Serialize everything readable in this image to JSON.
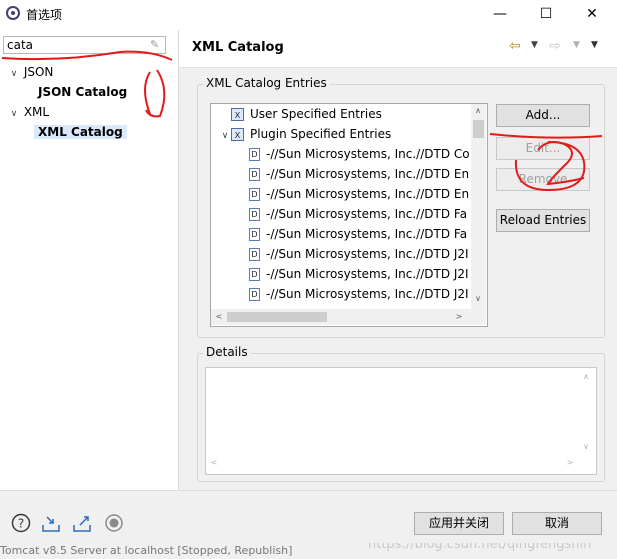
{
  "window": {
    "title": "首选项",
    "controls": {
      "minimize": "—",
      "maximize": "☐",
      "close": "✕"
    }
  },
  "filter": {
    "value": "cata"
  },
  "tree": [
    {
      "label": "JSON",
      "expanded": true
    },
    {
      "label": "JSON Catalog",
      "bold": true
    },
    {
      "label": "XML",
      "expanded": true
    },
    {
      "label": "XML Catalog",
      "bold": true,
      "selected": true
    }
  ],
  "page": {
    "title": "XML Catalog"
  },
  "entries_group": {
    "legend": "XML Catalog Entries",
    "items": [
      {
        "label": "User Specified Entries",
        "icon": "catalog-icon"
      },
      {
        "label": "Plugin Specified Entries",
        "icon": "catalog-icon",
        "expanded": true
      },
      {
        "label": "-//Sun Microsystems, Inc.//DTD Co",
        "icon": "dtd-icon"
      },
      {
        "label": "-//Sun Microsystems, Inc.//DTD En",
        "icon": "dtd-icon"
      },
      {
        "label": "-//Sun Microsystems, Inc.//DTD En",
        "icon": "dtd-icon"
      },
      {
        "label": "-//Sun Microsystems, Inc.//DTD Fa",
        "icon": "dtd-icon"
      },
      {
        "label": "-//Sun Microsystems, Inc.//DTD Fa",
        "icon": "dtd-icon"
      },
      {
        "label": "-//Sun Microsystems, Inc.//DTD J2I",
        "icon": "dtd-icon"
      },
      {
        "label": "-//Sun Microsystems, Inc.//DTD J2I",
        "icon": "dtd-icon"
      },
      {
        "label": "-//Sun Microsystems, Inc.//DTD J2I",
        "icon": "dtd-icon"
      }
    ],
    "buttons": {
      "add": "Add...",
      "edit": "Edit...",
      "remove": "Remove",
      "reload": "Reload Entries"
    }
  },
  "details_group": {
    "legend": "Details"
  },
  "footer": {
    "apply_close": "应用并关闭",
    "cancel": "取消"
  },
  "status_behind": "Tomcat v8.5 Server at localhost  [Stopped, Republish]",
  "watermark": "https://blog.csdn.net/qingfengshin",
  "annotations": {
    "one": "1",
    "two": "2"
  },
  "colors": {
    "annotation": "#e31a1a",
    "selection": "#d9e8fb",
    "panel": "#f0f0f0"
  }
}
